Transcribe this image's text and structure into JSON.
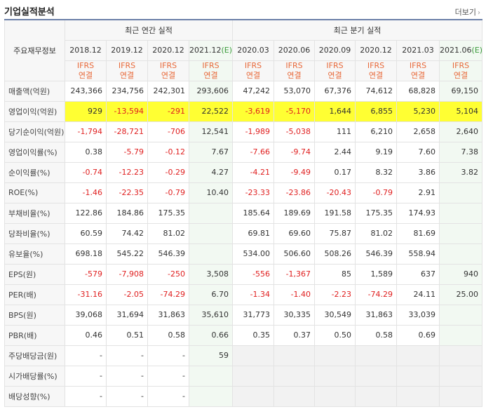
{
  "header": {
    "title": "기업실적분석",
    "more": "더보기",
    "more_icon": "chevron-right-icon"
  },
  "table": {
    "key_header": "주요재무정보",
    "annual_group": "최근 연간 실적",
    "quarter_group": "최근 분기 실적",
    "periods": [
      {
        "label": "2018.12",
        "est": ""
      },
      {
        "label": "2019.12",
        "est": ""
      },
      {
        "label": "2020.12",
        "est": ""
      },
      {
        "label": "2021.12",
        "est": "(E)"
      },
      {
        "label": "2020.03",
        "est": ""
      },
      {
        "label": "2020.06",
        "est": ""
      },
      {
        "label": "2020.09",
        "est": ""
      },
      {
        "label": "2020.12",
        "est": ""
      },
      {
        "label": "2021.03",
        "est": ""
      },
      {
        "label": "2021.06",
        "est": "(E)"
      }
    ],
    "ifrs": {
      "top": "IFRS",
      "sub": "연결"
    },
    "highlight_color": "#ffff33",
    "rows": [
      {
        "label": "매출액(억원)",
        "values": [
          "243,366",
          "234,756",
          "242,301",
          "293,606",
          "47,242",
          "53,070",
          "67,376",
          "74,612",
          "68,828",
          "69,150"
        ]
      },
      {
        "label": "영업이익(억원)",
        "highlight": true,
        "values": [
          "929",
          "-13,594",
          "-291",
          "22,522",
          "-3,619",
          "-5,170",
          "1,644",
          "6,855",
          "5,230",
          "5,104"
        ]
      },
      {
        "label": "당기순이익(억원)",
        "values": [
          "-1,794",
          "-28,721",
          "-706",
          "12,541",
          "-1,989",
          "-5,038",
          "111",
          "6,210",
          "2,658",
          "2,640"
        ]
      },
      {
        "label": "영업이익률(%)",
        "values": [
          "0.38",
          "-5.79",
          "-0.12",
          "7.67",
          "-7.66",
          "-9.74",
          "2.44",
          "9.19",
          "7.60",
          "7.38"
        ]
      },
      {
        "label": "순이익률(%)",
        "values": [
          "-0.74",
          "-12.23",
          "-0.29",
          "4.27",
          "-4.21",
          "-9.49",
          "0.17",
          "8.32",
          "3.86",
          "3.82"
        ]
      },
      {
        "label": "ROE(%)",
        "values": [
          "-1.46",
          "-22.35",
          "-0.79",
          "10.40",
          "-23.33",
          "-23.86",
          "-20.43",
          "-0.79",
          "2.91",
          ""
        ]
      },
      {
        "label": "부채비율(%)",
        "values": [
          "122.86",
          "184.86",
          "175.35",
          "",
          "185.64",
          "189.69",
          "191.58",
          "175.35",
          "174.93",
          ""
        ]
      },
      {
        "label": "당좌비율(%)",
        "values": [
          "60.59",
          "74.42",
          "81.02",
          "",
          "69.81",
          "69.60",
          "75.87",
          "81.02",
          "81.69",
          ""
        ]
      },
      {
        "label": "유보율(%)",
        "values": [
          "698.18",
          "545.22",
          "546.39",
          "",
          "534.00",
          "506.60",
          "508.26",
          "546.39",
          "558.94",
          ""
        ]
      },
      {
        "label": "EPS(원)",
        "values": [
          "-579",
          "-7,908",
          "-250",
          "3,508",
          "-556",
          "-1,367",
          "85",
          "1,589",
          "637",
          "940"
        ]
      },
      {
        "label": "PER(배)",
        "values": [
          "-31.16",
          "-2.05",
          "-74.29",
          "6.70",
          "-1.34",
          "-1.40",
          "-2.23",
          "-74.29",
          "24.11",
          "25.00"
        ]
      },
      {
        "label": "BPS(원)",
        "values": [
          "39,068",
          "31,694",
          "31,863",
          "35,610",
          "31,773",
          "30,335",
          "30,549",
          "31,863",
          "33,039",
          ""
        ]
      },
      {
        "label": "PBR(배)",
        "values": [
          "0.46",
          "0.51",
          "0.58",
          "0.66",
          "0.35",
          "0.37",
          "0.50",
          "0.58",
          "0.69",
          ""
        ]
      },
      {
        "label": "주당배당금(원)",
        "annual_only": true,
        "values": [
          "-",
          "-",
          "-",
          "59",
          "",
          "",
          "",
          "",
          "",
          ""
        ]
      },
      {
        "label": "시가배당률(%)",
        "annual_only": true,
        "values": [
          "-",
          "-",
          "-",
          "",
          "",
          "",
          "",
          "",
          "",
          ""
        ]
      },
      {
        "label": "배당성향(%)",
        "annual_only": true,
        "values": [
          "-",
          "-",
          "-",
          "",
          "",
          "",
          "",
          "",
          "",
          ""
        ]
      }
    ]
  }
}
